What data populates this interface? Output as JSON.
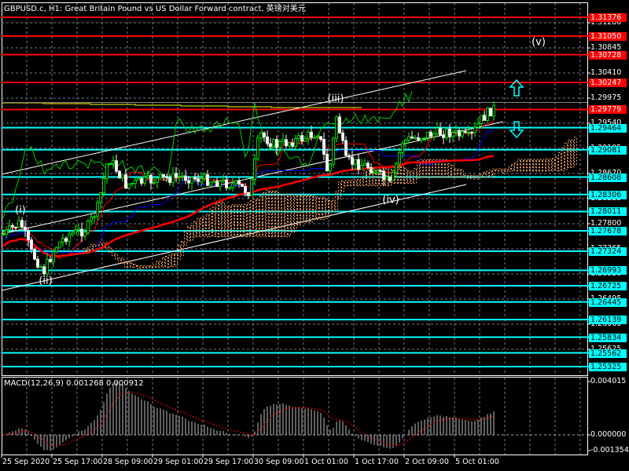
{
  "title": "GBPUSD.c, H1:  Great Britain Pound vs US Dollar Forward contract, 英镑对美元",
  "colors": {
    "background": "#000000",
    "resistance": "#ff0000",
    "support": "#00ffff",
    "bull_candle": "#00ff00",
    "bear_candle": "#ffffff",
    "ma": "#ff0000",
    "kijun": "#0000ff",
    "chikou": "#00cc00",
    "cloud": "#f4a460",
    "macd_hist": "#c0c0c0",
    "macd_signal": "#ff0000",
    "channel": "#ffffff",
    "yellow_line": "#ffff00"
  },
  "price_axis": {
    "grid_labels": [
      "1.31280",
      "1.30845",
      "1.30410",
      "1.29975",
      "1.29540",
      "1.29105",
      "1.28670",
      "1.28235",
      "1.27800",
      "1.27365",
      "1.26930",
      "1.26495",
      "1.26060",
      "1.25625"
    ],
    "current_price": "1.29900"
  },
  "levels": {
    "resistance": [
      "1.31376",
      "1.31050",
      "1.30728",
      "1.30247",
      "1.29779"
    ],
    "support": [
      "1.29464",
      "1.29081",
      "1.28608",
      "1.28306",
      "1.28011",
      "1.27678",
      "1.27324",
      "1.26993",
      "1.26725",
      "1.26445",
      "1.26139",
      "1.25834",
      "1.25562",
      "1.25325"
    ]
  },
  "wave_labels": [
    "(i)",
    "(ii)",
    "(iii)",
    "(iv)",
    "(v)"
  ],
  "arrows": [
    "arrow-up-icon",
    "arrow-down-icon"
  ],
  "macd": {
    "title": "MACD(12,26,9) 0.001268 0.000912",
    "axis_labels": [
      "0.004015",
      "0.000000",
      "-0.001354"
    ]
  },
  "time_axis": [
    "25 Sep 2020",
    "25 Sep 17:00",
    "28 Sep 09:00",
    "29 Sep 01:00",
    "29 Sep 17:00",
    "30 Sep 09:00",
    "1 Oct 01:00",
    "1 Oct 17:00",
    "2 Oct 09:00",
    "5 Oct 01:00"
  ]
}
